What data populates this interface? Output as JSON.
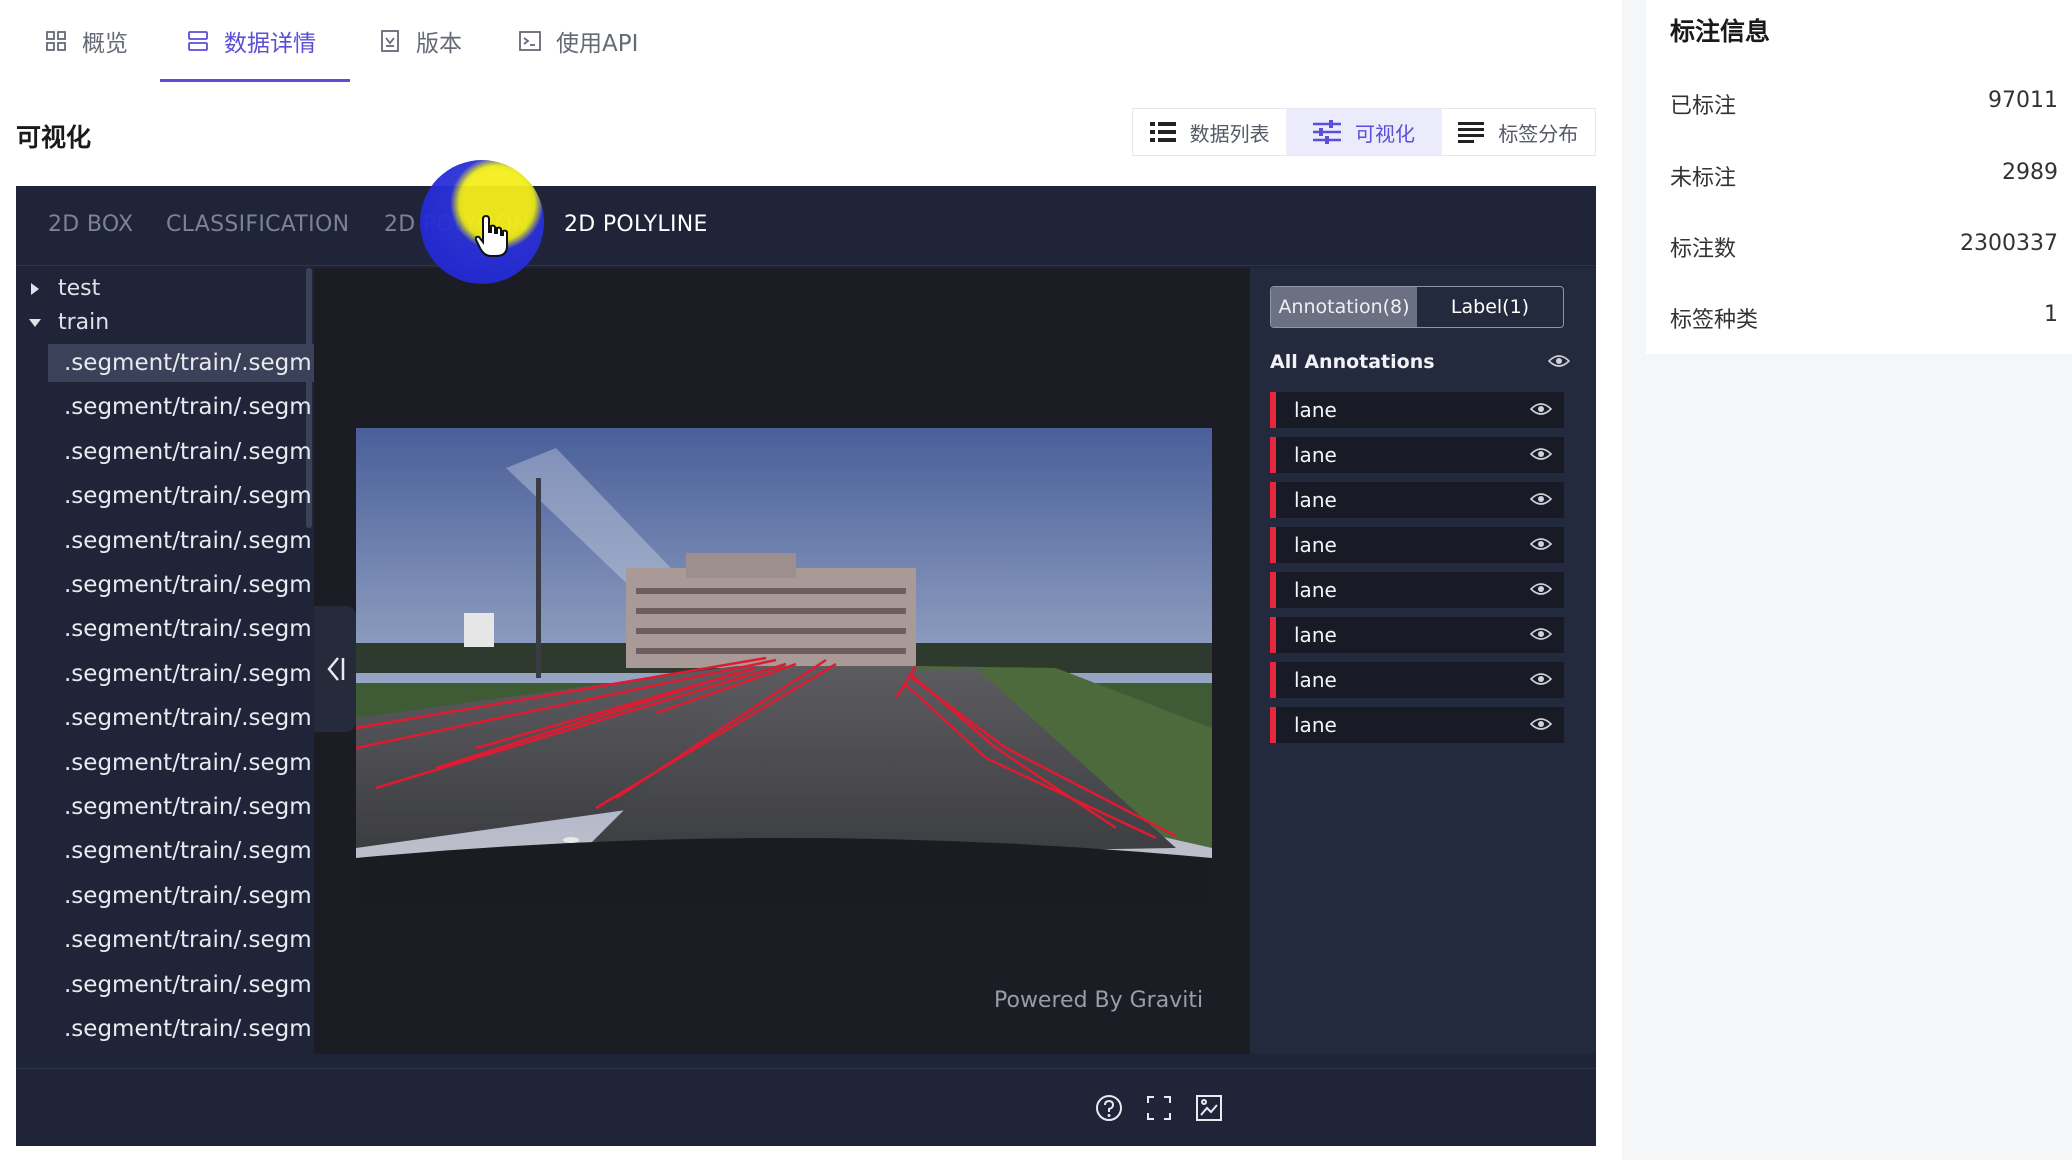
{
  "top_tabs": [
    {
      "label": "概览",
      "icon": "grid-icon"
    },
    {
      "label": "数据详情",
      "icon": "database-icon"
    },
    {
      "label": "版本",
      "icon": "version-icon"
    },
    {
      "label": "使用API",
      "icon": "terminal-icon"
    }
  ],
  "section_title": "可视化",
  "view_switch": [
    {
      "label": "数据列表",
      "icon": "list-icon"
    },
    {
      "label": "可视化",
      "icon": "sliders-icon"
    },
    {
      "label": "标签分布",
      "icon": "lines-icon"
    }
  ],
  "type_tabs": [
    "2D BOX",
    "CLASSIFICATION",
    "2D POLYGON",
    "2D POLYLINE"
  ],
  "active_type_tab": "2D POLYLINE",
  "tree": {
    "nodes": [
      {
        "label": "test",
        "expanded": false
      },
      {
        "label": "train",
        "expanded": true
      }
    ],
    "files": [
      ".segment/train/.segm...",
      ".segment/train/.segm...",
      ".segment/train/.segm...",
      ".segment/train/.segm...",
      ".segment/train/.segm...",
      ".segment/train/.segm...",
      ".segment/train/.segm...",
      ".segment/train/.segm...",
      ".segment/train/.segm...",
      ".segment/train/.segm...",
      ".segment/train/.segm...",
      ".segment/train/.segm...",
      ".segment/train/.segm...",
      ".segment/train/.segm...",
      ".segment/train/.segm...",
      ".segment/train/.segm..."
    ]
  },
  "powered_by": "Powered By Graviti",
  "annotation_panel": {
    "tabs": [
      "Annotation(8)",
      "Label(1)"
    ],
    "all_label": "All Annotations",
    "items": [
      "lane",
      "lane",
      "lane",
      "lane",
      "lane",
      "lane",
      "lane",
      "lane"
    ],
    "item_color": "#e8263c"
  },
  "bottom_icons": [
    "help-icon",
    "fullscreen-icon",
    "fit-image-icon"
  ],
  "info": {
    "title": "标注信息",
    "rows": [
      {
        "label": "已标注",
        "value": "97011"
      },
      {
        "label": "未标注",
        "value": "2989"
      },
      {
        "label": "标注数",
        "value": "2300337"
      },
      {
        "label": "标签种类",
        "value": "1"
      }
    ]
  },
  "colors": {
    "accent": "#5a4fd6",
    "viewer_bg": "#1f2438",
    "lane": "#e8263c"
  }
}
